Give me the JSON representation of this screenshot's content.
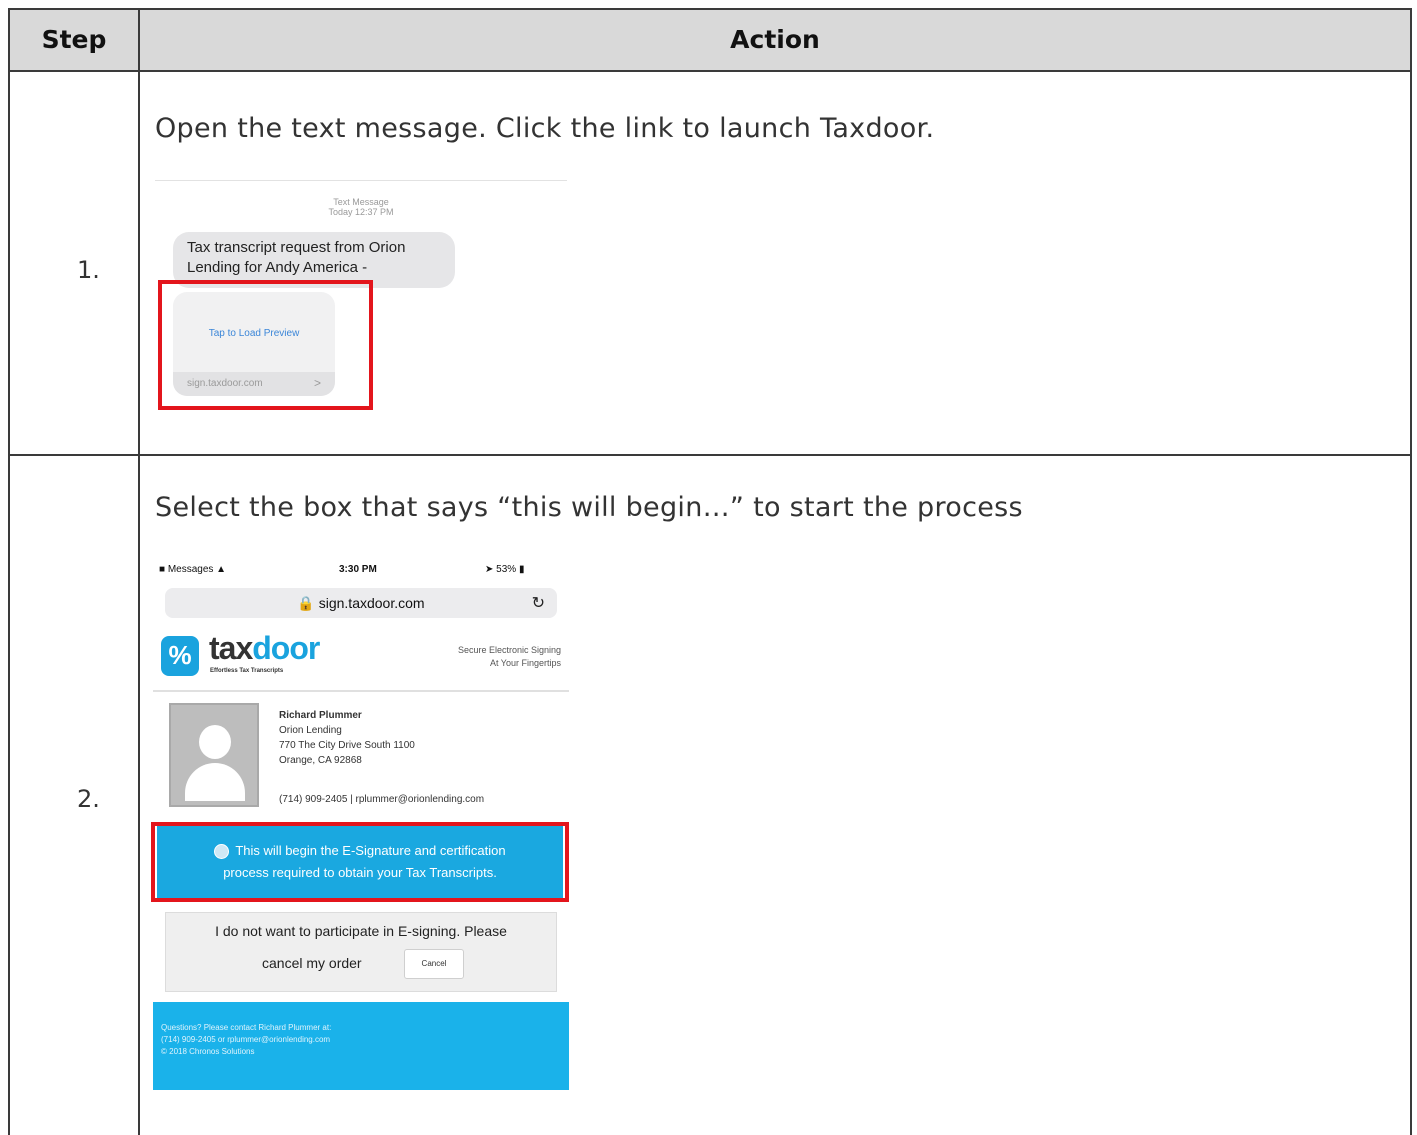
{
  "table": {
    "headers": {
      "step": "Step",
      "action": "Action"
    },
    "rows": [
      {
        "step": "1.",
        "instruction": "Open the text message. Click the link to launch Taxdoor.",
        "screenshot": {
          "meta_title": "Text Message",
          "meta_time": "Today 12:37 PM",
          "bubble_line1": "Tax transcript request from Orion",
          "bubble_line2": "Lending for Andy America -",
          "preview_link": "Tap to Load Preview",
          "preview_url": "sign.taxdoor.com",
          "preview_chevron": ">"
        }
      },
      {
        "step": "2.",
        "instruction": "Select the box that says “this will begin…” to start the process",
        "screenshot": {
          "status_app": "Messages",
          "status_time": "3:30 PM",
          "status_battery": "53%",
          "url": "sign.taxdoor.com",
          "logo_tax": "tax",
          "logo_door": "door",
          "logo_tagline": "Effortless Tax Transcripts",
          "secure_line1": "Secure Electronic Signing",
          "secure_line2": "At Your Fingertips",
          "contact_name": "Richard Plummer",
          "contact_company": "Orion Lending",
          "contact_address1": "770 The City Drive South 1100",
          "contact_address2": "Orange, CA 92868",
          "contact_phone_email": "(714) 909-2405 | rplummer@orionlending.com",
          "cta_line1": "This will begin the E-Signature and certification",
          "cta_line2": "process required to obtain your Tax Transcripts.",
          "optout_line1": "I do not want to participate in E-signing. Please",
          "optout_line2": "cancel my order",
          "cancel_label": "Cancel",
          "footer_line1": "Questions? Please contact Richard Plummer at:",
          "footer_line2": "(714) 909-2405 or rplummer@orionlending.com",
          "footer_line3": "© 2018 Chronos Solutions"
        }
      }
    ]
  },
  "colors": {
    "header_bg": "#d9d9d9",
    "highlight": "#e3151c",
    "brand_blue": "#1aa3de"
  }
}
